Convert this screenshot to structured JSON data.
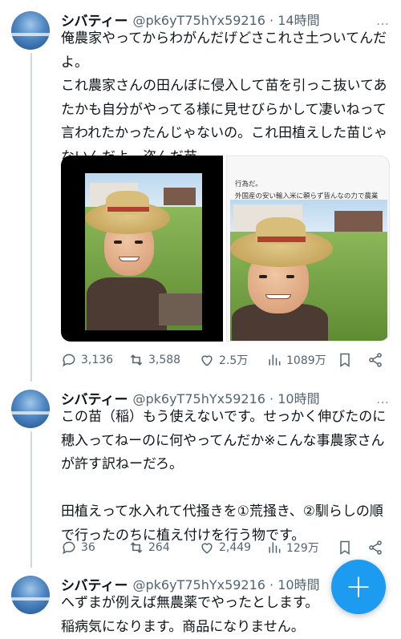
{
  "tweets": [
    {
      "name": "シバティー",
      "handle": "@pk6yT75hYx59216 · 14時間",
      "text": "俺農家やってからわがんだげどさこれさ土ついてんだよ。\nこれ農家さんの田んぼに侵入して苗を引っこ抜いてあたかも自分がやってる様に見せびらかして凄いねって言われたかったんじゃないの。これ田植えした苗じゃないんだよ。盗んだ苗",
      "media_caption": "行為だ。\n外国産の安い輸入米に頼らず皆んなの力で農業を取り上げよう。",
      "replies": "3,136",
      "reposts": "3,588",
      "likes": "2.5万",
      "views": "1089万"
    },
    {
      "name": "シバティー",
      "handle": "@pk6yT75hYx59216 · 10時間",
      "text": "この苗（稲）もう使えないです。せっかく伸びたのに穂入ってねーのに何やってんだか※こんな事農家さんが許す訳ねーだろ。\n\n田植えって水入れて代掻きを①荒掻き、②馴らしの順で行ったのちに植え付けを行う物です。",
      "replies": "36",
      "reposts": "264",
      "likes": "2,449",
      "views": "129万"
    },
    {
      "name": "シバティー",
      "handle": "@pk6yT75hYx59216 · 10時間",
      "text": "へずまが例えば無農薬でやったとします。\n稲病気になります。商品になりません。"
    }
  ],
  "more_icon": "…",
  "fab_label": "+",
  "colors": {
    "accent": "#1d9bf0",
    "muted": "#536471",
    "thread": "#cfd9de"
  }
}
